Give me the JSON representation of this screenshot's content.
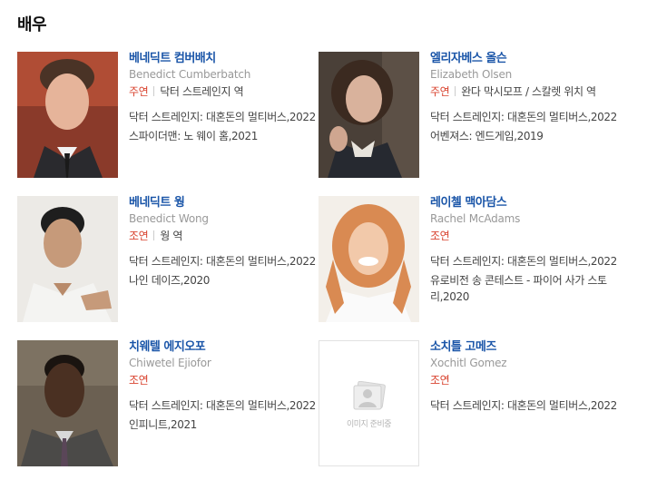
{
  "section": {
    "title": "배우"
  },
  "actors": [
    {
      "name_ko": "베네딕트 컴버배치",
      "name_en": "Benedict Cumberbatch",
      "role_type": "주연",
      "role": "닥터 스트레인지 역",
      "works": [
        "닥터 스트레인지: 대혼돈의 멀티버스,2022",
        "스파이더맨: 노 웨이 홈,2021"
      ]
    },
    {
      "name_ko": "엘리자베스 올슨",
      "name_en": "Elizabeth Olsen",
      "role_type": "주연",
      "role": "완다 막시모프 / 스칼렛 위치 역",
      "works": [
        "닥터 스트레인지: 대혼돈의 멀티버스,2022",
        "어벤져스: 엔드게임,2019"
      ]
    },
    {
      "name_ko": "베네딕트 웡",
      "name_en": "Benedict Wong",
      "role_type": "조연",
      "role": "웡 역",
      "works": [
        "닥터 스트레인지: 대혼돈의 멀티버스,2022",
        "나인 데이즈,2020"
      ]
    },
    {
      "name_ko": "레이첼 맥아담스",
      "name_en": "Rachel McAdams",
      "role_type": "조연",
      "role": "",
      "works": [
        "닥터 스트레인지: 대혼돈의 멀티버스,2022",
        "유로비전 송 콘테스트 - 파이어 사가 스토리,2020"
      ]
    },
    {
      "name_ko": "치웨텔 에지오포",
      "name_en": "Chiwetel Ejiofor",
      "role_type": "조연",
      "role": "",
      "works": [
        "닥터 스트레인지: 대혼돈의 멀티버스,2022",
        "인피니트,2021"
      ]
    },
    {
      "name_ko": "소치틀 고메즈",
      "name_en": "Xochitl Gomez",
      "role_type": "조연",
      "role": "",
      "works": [
        "닥터 스트레인지: 대혼돈의 멀티버스,2022"
      ]
    }
  ],
  "placeholder": {
    "text": "이미지 준비중",
    "icon": "image-placeholder-icon"
  },
  "colors": {
    "name_link": "#1a55a8",
    "role_type": "#d9432f",
    "english_name": "#999999"
  }
}
